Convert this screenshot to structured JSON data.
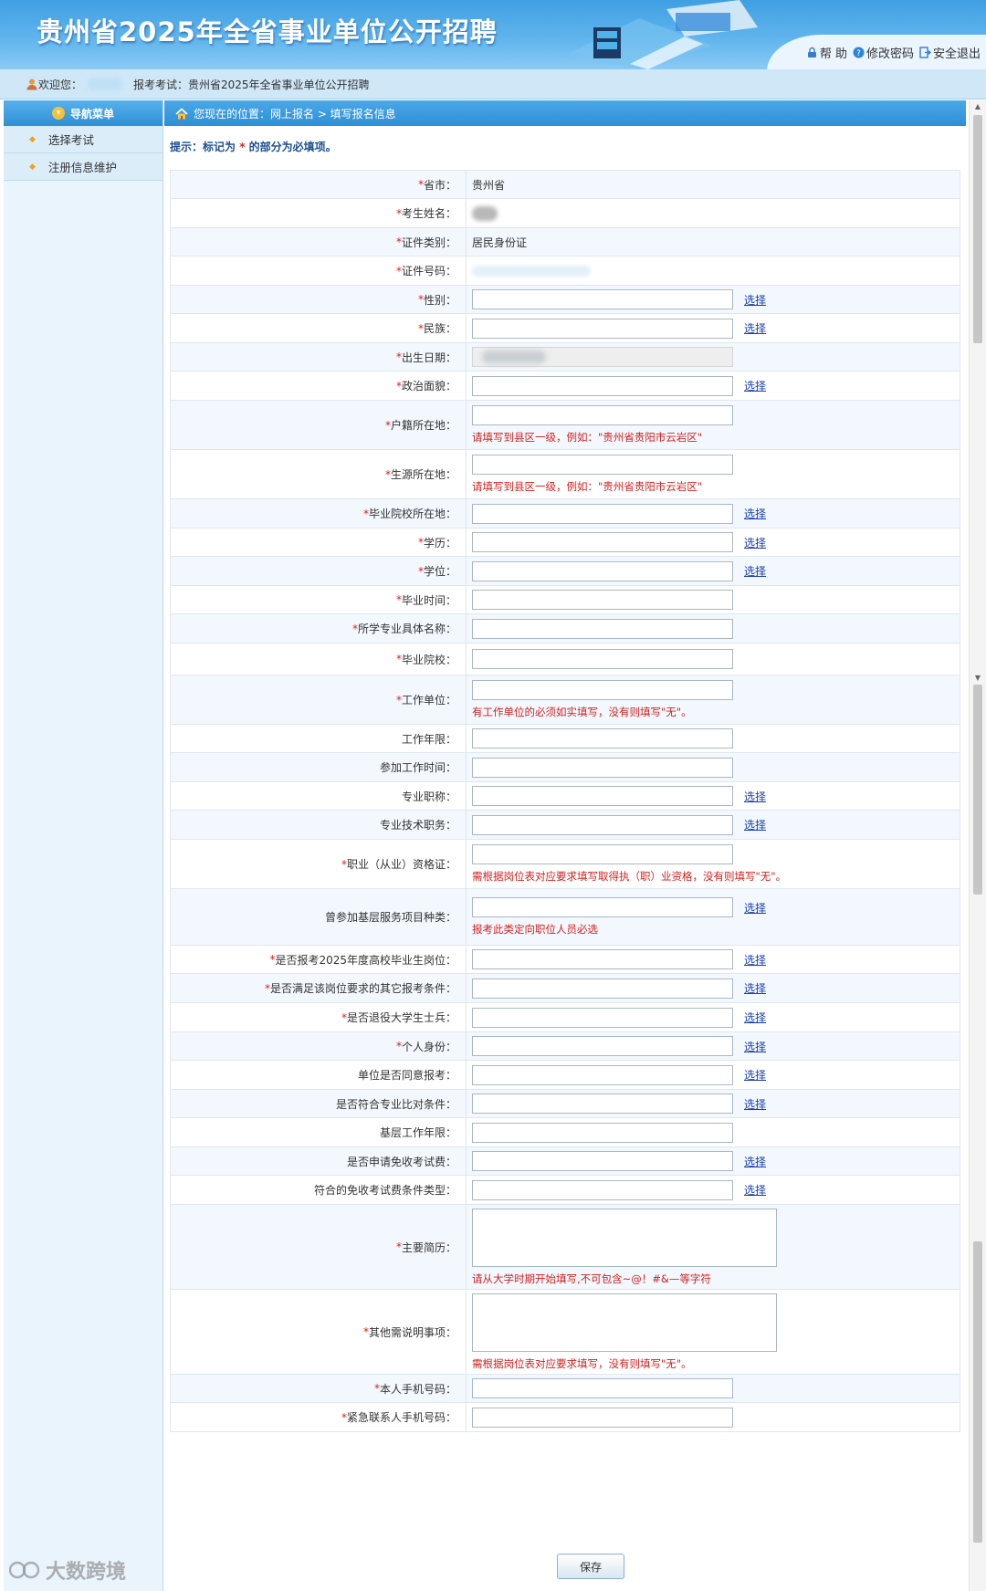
{
  "header": {
    "title": "贵州省2025年全省事业单位公开招聘",
    "links": [
      {
        "label": "帮 助",
        "icon": "lock-icon",
        "color": "#3a7cc8"
      },
      {
        "label": "修改密码",
        "icon": "help-icon",
        "color": "#2b86d8"
      },
      {
        "label": "安全退出",
        "icon": "exit-icon",
        "color": "#3a7cc8"
      }
    ]
  },
  "welcome": {
    "greeting": "欢迎您：",
    "exam_label": "报考考试：贵州省2025年全省事业单位公开招聘"
  },
  "sidebar": {
    "title": "导航菜单",
    "items": [
      {
        "label": "选择考试"
      },
      {
        "label": "注册信息维护"
      }
    ]
  },
  "breadcrumb": {
    "text": "您现在的位置：网上报名  >  填写报名信息"
  },
  "hint": {
    "prefix": "提示：标记为",
    "star": "*",
    "suffix": "的部分为必填项。"
  },
  "form": {
    "pick_label": "选择",
    "fields": [
      {
        "label": "省市：",
        "req": true,
        "type": "text",
        "value": "贵州省"
      },
      {
        "label": "考生姓名：",
        "req": true,
        "type": "blurred"
      },
      {
        "label": "证件类别：",
        "req": true,
        "type": "text",
        "value": "居民身份证"
      },
      {
        "label": "证件号码：",
        "req": true,
        "type": "blurred-id"
      },
      {
        "label": "性别：",
        "req": true,
        "type": "input",
        "pick": true
      },
      {
        "label": "民族：",
        "req": true,
        "type": "input",
        "pick": true
      },
      {
        "label": "出生日期：",
        "req": true,
        "type": "disabled"
      },
      {
        "label": "政治面貌：",
        "req": true,
        "type": "input",
        "pick": true
      },
      {
        "label": "户籍所在地：",
        "req": true,
        "type": "input",
        "note": "请填写到县区一级，例如：\"贵州省贵阳市云岩区\""
      },
      {
        "label": "生源所在地：",
        "req": true,
        "type": "input",
        "note": "请填写到县区一级，例如：\"贵州省贵阳市云岩区\""
      },
      {
        "label": "毕业院校所在地：",
        "req": true,
        "type": "input",
        "pick": true
      },
      {
        "label": "学历：",
        "req": true,
        "type": "input",
        "pick": true
      },
      {
        "label": "学位：",
        "req": true,
        "type": "input",
        "pick": true
      },
      {
        "label": "毕业时间：",
        "req": true,
        "type": "input"
      },
      {
        "label": "所学专业具体名称：",
        "req": true,
        "type": "input"
      },
      {
        "label": "毕业院校：",
        "req": true,
        "type": "input"
      },
      {
        "label": "工作单位：",
        "req": true,
        "type": "input",
        "note": "有工作单位的必须如实填写，没有则填写\"无\"。"
      },
      {
        "label": "工作年限：",
        "req": false,
        "type": "input"
      },
      {
        "label": "参加工作时间：",
        "req": false,
        "type": "input"
      },
      {
        "label": "专业职称：",
        "req": false,
        "type": "input",
        "pick": true
      },
      {
        "label": "专业技术职务：",
        "req": false,
        "type": "input",
        "pick": true
      },
      {
        "label": "职业（从业）资格证：",
        "req": true,
        "type": "input",
        "note": "需根据岗位表对应要求填写取得执（职）业资格，没有则填写\"无\"。"
      },
      {
        "label": "曾参加基层服务项目种类：",
        "req": false,
        "type": "input",
        "pick": true,
        "note": "报考此类定向职位人员必选"
      },
      {
        "label": "是否报考2025年度高校毕业生岗位：",
        "req": true,
        "type": "input",
        "pick": true
      },
      {
        "label": "是否满足该岗位要求的其它报考条件：",
        "req": true,
        "type": "input",
        "pick": true
      },
      {
        "label": "是否退役大学生士兵：",
        "req": true,
        "type": "input",
        "pick": true
      },
      {
        "label": "个人身份：",
        "req": true,
        "type": "input",
        "pick": true
      },
      {
        "label": "单位是否同意报考：",
        "req": false,
        "type": "input",
        "pick": true
      },
      {
        "label": "是否符合专业比对条件：",
        "req": false,
        "type": "input",
        "pick": true
      },
      {
        "label": "基层工作年限：",
        "req": false,
        "type": "input"
      },
      {
        "label": "是否申请免收考试费：",
        "req": false,
        "type": "input",
        "pick": true
      },
      {
        "label": "符合的免收考试费条件类型：",
        "req": false,
        "type": "input",
        "pick": true
      },
      {
        "label": "主要简历：",
        "req": true,
        "type": "textarea",
        "note": "请从大学时期开始填写,不可包含~@！#&—等字符"
      },
      {
        "label": "其他需说明事项：",
        "req": true,
        "type": "textarea",
        "note": "需根据岗位表对应要求填写，没有则填写\"无\"。"
      },
      {
        "label": "本人手机号码：",
        "req": true,
        "type": "input"
      },
      {
        "label": "紧急联系人手机号码：",
        "req": true,
        "type": "input"
      }
    ],
    "save_label": "保存"
  },
  "watermark": {
    "text": "大数跨境"
  },
  "colors": {
    "header_blue": "#3f9fe3",
    "nav_blue": "#2f8fd6",
    "required_red": "#e02020",
    "link_blue": "#1a3fb0"
  }
}
